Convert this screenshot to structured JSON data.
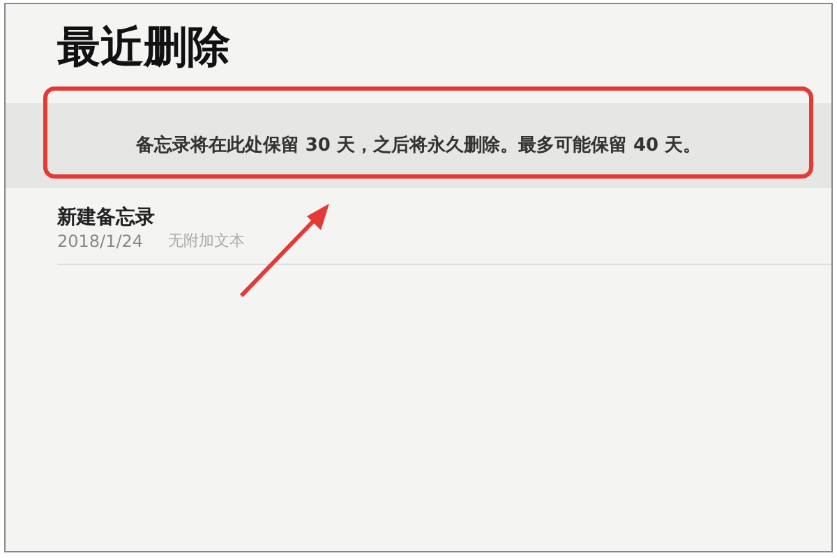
{
  "title": "最近删除",
  "notice": "备忘录将在此处保留 30 天，之后将永久删除。最多可能保留 40 天。",
  "notes": [
    {
      "title": "新建备忘录",
      "date": "2018/1/24",
      "preview": "无附加文本"
    }
  ]
}
